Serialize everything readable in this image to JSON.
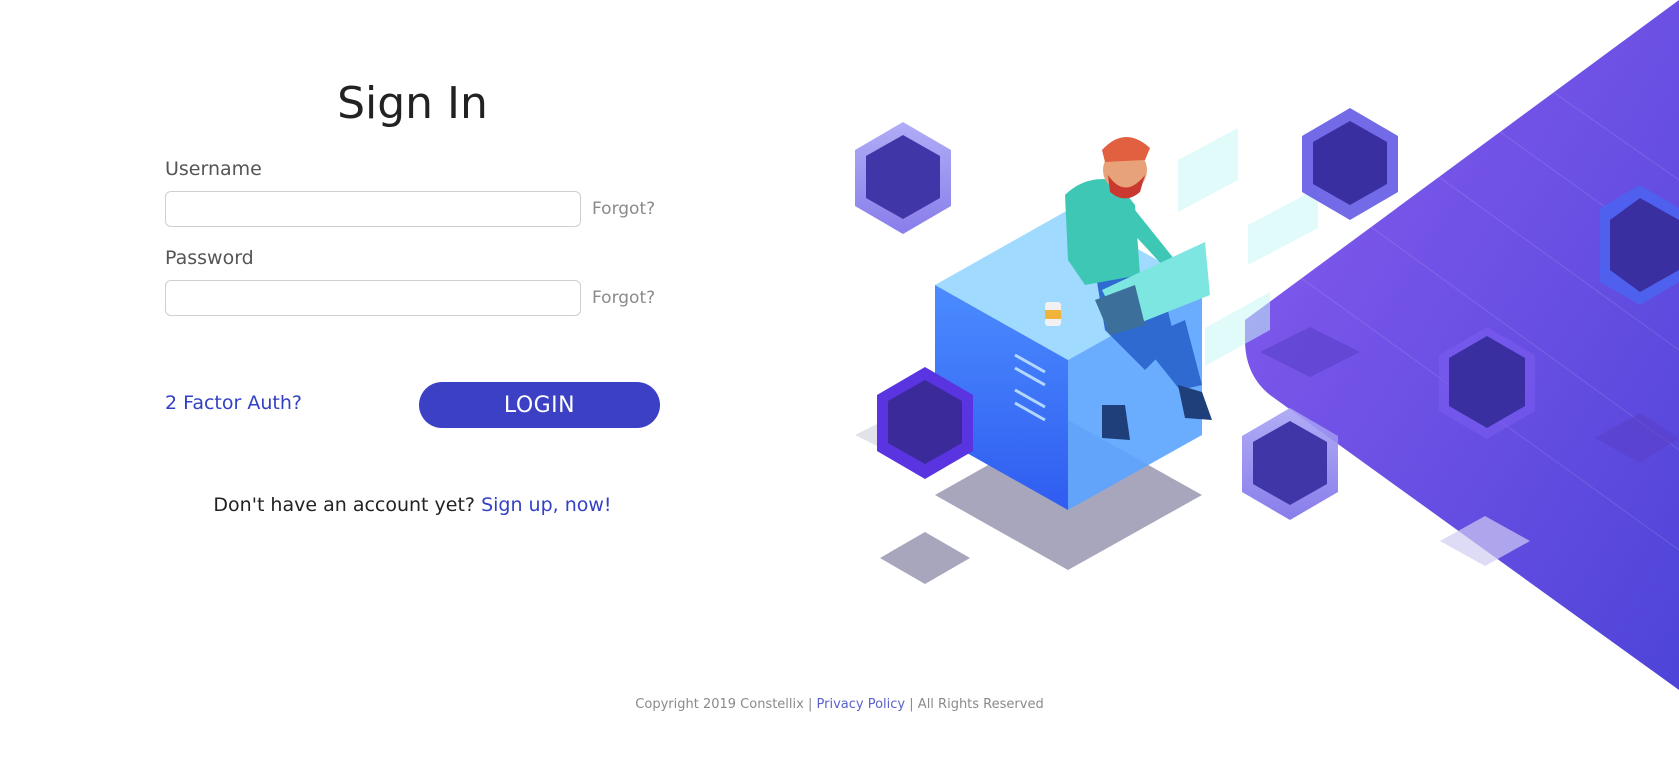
{
  "heading": "Sign In",
  "form": {
    "username_label": "Username",
    "username_value": "",
    "username_forgot": "Forgot?",
    "password_label": "Password",
    "password_value": "",
    "password_forgot": "Forgot?"
  },
  "actions": {
    "two_factor": "2 Factor Auth?",
    "login": "LOGIN"
  },
  "signup": {
    "prompt": "Don't have an account yet?",
    "link": "Sign up, now!"
  },
  "footer": {
    "copyright": "Copyright 2019 Constellix",
    "sep1": "|",
    "privacy": "Privacy Policy",
    "sep2": "|",
    "rights": "All Rights Reserved"
  },
  "colors": {
    "accent": "#3b40c4",
    "link": "#3340c4",
    "gradient_start": "#8a5cf0",
    "gradient_end": "#4e44d8"
  },
  "illustration": {
    "icons": [
      "person-with-laptop-icon",
      "server-cube-icon",
      "server-hexagon-icon",
      "coffee-cup-icon"
    ]
  }
}
